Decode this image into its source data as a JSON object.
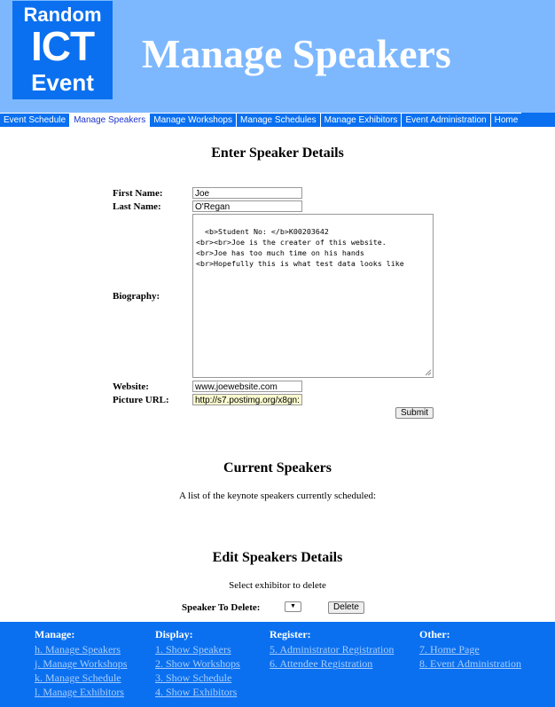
{
  "logo": {
    "line1": "Random",
    "line2": "ICT",
    "line3": "Event"
  },
  "page_title": "Manage Speakers",
  "nav": [
    {
      "label": "Event Schedule",
      "active": false
    },
    {
      "label": "Manage Speakers",
      "active": true
    },
    {
      "label": "Manage Workshops",
      "active": false
    },
    {
      "label": "Manage Schedules",
      "active": false
    },
    {
      "label": "Manage Exhibitors",
      "active": false
    },
    {
      "label": "Event Administration",
      "active": false
    },
    {
      "label": "Home",
      "active": false
    }
  ],
  "form": {
    "heading": "Enter Speaker Details",
    "first_name_label": "First Name:",
    "first_name_value": "Joe",
    "last_name_label": "Last Name:",
    "last_name_value": "O'Regan",
    "biography_label": "Biography:",
    "biography_value": "<b>Student No: </b>K00203642\n<br><br>Joe is the creater of this website.\n<br>Joe has too much time on his hands\n<br>Hopefully this is what test data looks like",
    "website_label": "Website:",
    "website_value": "www.joewebsite.com",
    "picture_label": "Picture URL:",
    "picture_value": "http://s7.postimg.org/x8gn:",
    "submit_label": "Submit"
  },
  "current": {
    "heading": "Current Speakers",
    "text": "A list of the keynote speakers currently scheduled:"
  },
  "edit": {
    "heading": "Edit Speakers Details",
    "text": "Select exhibitor to delete",
    "delete_label": "Speaker To Delete:",
    "select_arrow": "▼",
    "delete_button": "Delete"
  },
  "footer": {
    "manage": {
      "title": "Manage:",
      "links": [
        "h. Manage Speakers",
        "j. Manage Workshops",
        "k. Manage Schedule",
        "l. Manage Exhibitors"
      ]
    },
    "display": {
      "title": "Display:",
      "links": [
        "1. Show Speakers",
        "2. Show Workshops",
        "3. Show Schedule",
        "4. Show Exhibitors"
      ]
    },
    "register": {
      "title": "Register:",
      "links": [
        "5. Administrator Registration",
        "6. Attendee Registration"
      ]
    },
    "other": {
      "title": "Other:",
      "links": [
        "7. Home Page",
        "8. Event Administration"
      ]
    }
  },
  "colors": {
    "header_bg": "#7db8ff",
    "nav_bg": "#0a70f0",
    "footer_bg": "#0a70f0",
    "link_color": "#a9cdfb",
    "picture_field_bg": "#fbfbd0"
  }
}
